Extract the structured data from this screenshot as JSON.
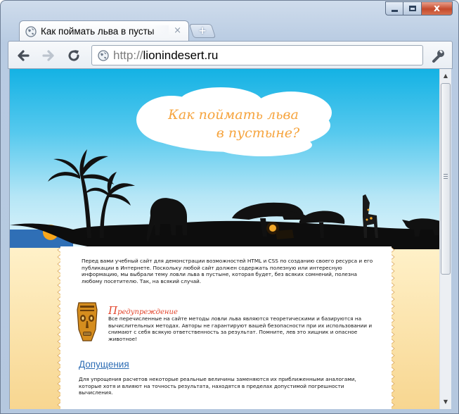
{
  "browser": {
    "tab_title": "Как поймать льва в пусты",
    "tab_close": "×",
    "new_tab": "+",
    "url_scheme": "http://",
    "url_host": "lionindesert.ru",
    "icons": {
      "back": "arrow-left-icon",
      "forward": "arrow-right-icon",
      "reload": "reload-icon",
      "wrench": "wrench-icon",
      "favicon": "globe-icon"
    },
    "window_controls": {
      "close": "x"
    }
  },
  "page": {
    "cloud_title_line1": "Как поймать льва",
    "cloud_title_line2": "в пустыне?",
    "intro": "Перед вами учебный сайт для демонстрации возможностей HTML и CSS по созданию своего ресурса и его публикации в Интернете. Поскольку любой сайт должен содержать полезную или интересную информацию, мы выбрали тему ловли льва в пустыне, которая будет, без всяких сомнений, полезна любому посетителю. Так, на всякий случай.",
    "warning_title_cap": "П",
    "warning_title_rest": "редупреждение",
    "warning_text": "Все перечисленные на сайте методы ловли льва являются теоретическими и базируются на вычислительных методах. Авторы не гарантируют вашей безопасности при их использовании и снимают с себя всякую ответственность за результат. Помните, лев это хищник и опасное животное!",
    "assumptions_heading": "Допущения",
    "assumptions_text": "Для упрощения расчетов некоторые реальные величины заменяются их приближенными аналогами, которые хотя и влияют на точность результата, находятся в пределах допустимой погрешности вычисления."
  },
  "colors": {
    "sky_top": "#14b2e4",
    "sand": "#f7d58e",
    "title_orange": "#f6a43e",
    "warning_red": "#e2432a",
    "link_blue": "#2c6cb4"
  }
}
